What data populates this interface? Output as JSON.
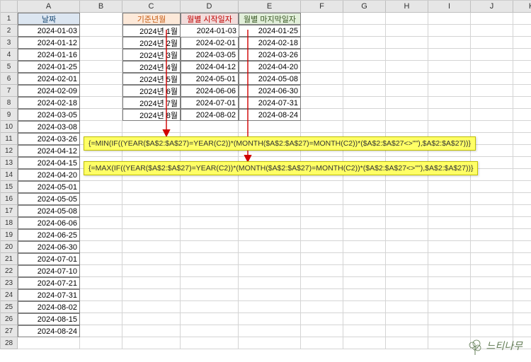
{
  "columns": [
    "",
    "A",
    "B",
    "C",
    "D",
    "E",
    "F",
    "G",
    "H",
    "I",
    "J",
    "K"
  ],
  "rows": [
    "1",
    "2",
    "3",
    "4",
    "5",
    "6",
    "7",
    "8",
    "9",
    "10",
    "11",
    "12",
    "13",
    "14",
    "15",
    "16",
    "17",
    "18",
    "19",
    "20",
    "21",
    "22",
    "23",
    "24",
    "25",
    "26",
    "27",
    "28"
  ],
  "headers": {
    "A1": "날짜",
    "C1": "기준년월",
    "D1": "월별 시작일자",
    "E1": "월별 마지막일자"
  },
  "colA": [
    "2024-01-03",
    "2024-01-12",
    "2024-01-16",
    "2024-01-25",
    "2024-02-01",
    "2024-02-09",
    "2024-02-18",
    "2024-03-05",
    "2024-03-08",
    "2024-03-26",
    "2024-04-12",
    "2024-04-15",
    "2024-04-20",
    "2024-05-01",
    "2024-05-05",
    "2024-05-08",
    "2024-06-06",
    "2024-06-25",
    "2024-06-30",
    "2024-07-01",
    "2024-07-10",
    "2024-07-21",
    "2024-07-31",
    "2024-08-02",
    "2024-08-15",
    "2024-08-24"
  ],
  "colC": [
    "2024년 1월",
    "2024년 2월",
    "2024년 3월",
    "2024년 4월",
    "2024년 5월",
    "2024년 6월",
    "2024년 7월",
    "2024년 8월"
  ],
  "colD": [
    "2024-01-03",
    "2024-02-01",
    "2024-03-05",
    "2024-04-12",
    "2024-05-01",
    "2024-06-06",
    "2024-07-01",
    "2024-08-02"
  ],
  "colE": [
    "2024-01-25",
    "2024-02-18",
    "2024-03-26",
    "2024-04-20",
    "2024-05-08",
    "2024-06-30",
    "2024-07-31",
    "2024-08-24"
  ],
  "formulas": {
    "min": "{=MIN(IF((YEAR($A$2:$A$27)=YEAR(C2))*(MONTH($A$2:$A$27)=MONTH(C2))*($A$2:$A$27<>\"\"),$A$2:$A$27))}",
    "max": "{=MAX(IF((YEAR($A$2:$A$27)=YEAR(C2))*(MONTH($A$2:$A$27)=MONTH(C2))*($A$2:$A$27<>\"\"),$A$2:$A$27))}"
  },
  "logo": "느티나무"
}
